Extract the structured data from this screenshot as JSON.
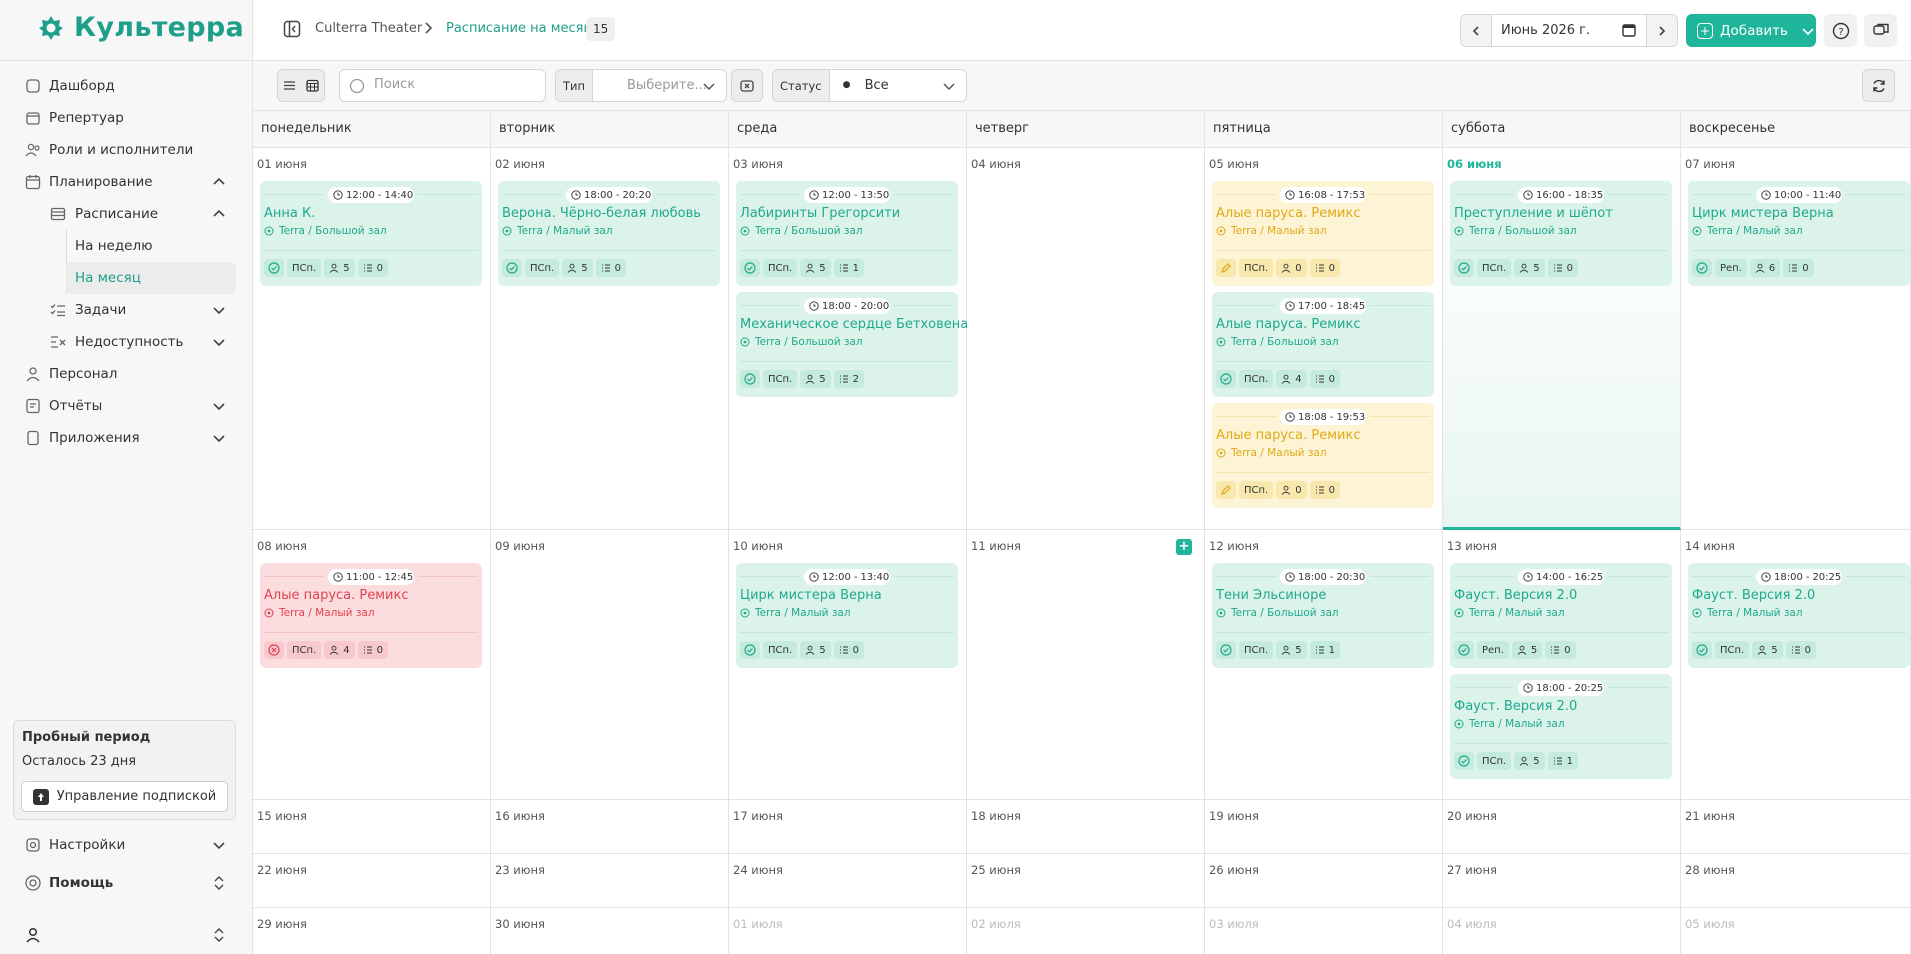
{
  "app": {
    "name": "Культерра"
  },
  "sidebar": {
    "items": [
      {
        "label": "Дашборд",
        "icon": "home-icon",
        "level": 0
      },
      {
        "label": "Репертуар",
        "icon": "repertoire-icon",
        "level": 0
      },
      {
        "label": "Роли и исполнители",
        "icon": "users-icon",
        "level": 0
      },
      {
        "label": "Планирование",
        "icon": "calendar-icon",
        "level": 0,
        "chevron": "up"
      },
      {
        "label": "Расписание",
        "icon": "table-icon",
        "level": 1,
        "chevron": "up"
      },
      {
        "label": "На неделю",
        "level": 2
      },
      {
        "label": "На месяц",
        "level": 2,
        "active": true
      },
      {
        "label": "Задачи",
        "icon": "tasks-icon",
        "level": 1,
        "chevron": "down"
      },
      {
        "label": "Недоступность",
        "icon": "unavailability-icon",
        "level": 1,
        "chevron": "down"
      },
      {
        "label": "Персонал",
        "icon": "staff-icon",
        "level": 0
      },
      {
        "label": "Отчёты",
        "icon": "report-icon",
        "level": 0,
        "chevron": "down"
      },
      {
        "label": "Приложения",
        "icon": "apps-icon",
        "level": 0,
        "chevron": "down"
      }
    ],
    "trial": {
      "title": "Пробный период",
      "remaining": "Осталось 23 дня",
      "button": "Управление подпиской"
    },
    "settings": "Настройки",
    "help": "Помощь"
  },
  "header": {
    "breadcrumb_root": "Culterra Theater",
    "breadcrumb_current": "Расписание на месяц",
    "count_badge": "15",
    "month": "Июнь 2026 г.",
    "add_button": "Добавить"
  },
  "toolbar": {
    "search_placeholder": "Поиск",
    "type_label": "Тип",
    "type_placeholder": "Выберите...",
    "status_label": "Статус",
    "status_value": "Все"
  },
  "colors": {
    "accent": "#1fb59a",
    "event_green": "#dcf3ea",
    "event_yellow": "#fdf4d6",
    "event_red": "#fbdde0"
  },
  "calendar": {
    "weekdays": [
      "понедельник",
      "вторник",
      "среда",
      "четверг",
      "пятница",
      "суббота",
      "воскресенье"
    ],
    "weeks": [
      [
        {
          "date": "01 июня",
          "events": [
            {
              "time_start": "12:00",
              "time_end": "14:40",
              "title": "Анна К.",
              "venue": "Terra / Большой зал",
              "color": "green",
              "status": "ok",
              "type": "ПСп.",
              "cast": "5",
              "tasks": "0"
            }
          ]
        },
        {
          "date": "02 июня",
          "events": [
            {
              "time_start": "18:00",
              "time_end": "20:20",
              "title": "Верона. Чёрно-белая любовь",
              "venue": "Terra / Малый зал",
              "color": "green",
              "status": "ok",
              "type": "ПСп.",
              "cast": "5",
              "tasks": "0"
            }
          ]
        },
        {
          "date": "03 июня",
          "events": [
            {
              "time_start": "12:00",
              "time_end": "13:50",
              "title": "Лабиринты Грегорсити",
              "venue": "Terra / Большой зал",
              "color": "green",
              "status": "ok",
              "type": "ПСп.",
              "cast": "5",
              "tasks": "1"
            },
            {
              "time_start": "18:00",
              "time_end": "20:00",
              "title": "Механическое сердце Бетховена",
              "venue": "Terra / Большой зал",
              "color": "green",
              "status": "ok",
              "type": "ПСп.",
              "cast": "5",
              "tasks": "2"
            }
          ]
        },
        {
          "date": "04 июня",
          "events": []
        },
        {
          "date": "05 июня",
          "events": [
            {
              "time_start": "16:08",
              "time_end": "17:53",
              "title": "Алые паруса. Ремикс",
              "venue": "Terra / Малый зал",
              "color": "yellow",
              "status": "draft",
              "type": "ПСп.",
              "cast": "0",
              "tasks": "0"
            },
            {
              "time_start": "17:00",
              "time_end": "18:45",
              "title": "Алые паруса. Ремикс",
              "venue": "Terra / Большой зал",
              "color": "green",
              "status": "ok",
              "type": "ПСп.",
              "cast": "4",
              "tasks": "0"
            },
            {
              "time_start": "18:08",
              "time_end": "19:53",
              "title": "Алые паруса. Ремикс",
              "venue": "Terra / Малый зал",
              "color": "yellow",
              "status": "draft",
              "type": "ПСп.",
              "cast": "0",
              "tasks": "0"
            }
          ]
        },
        {
          "date": "06 июня",
          "today": true,
          "events": [
            {
              "time_start": "16:00",
              "time_end": "18:35",
              "title": "Преступление и шёпот",
              "venue": "Terra / Большой зал",
              "color": "green",
              "status": "ok",
              "type": "ПСп.",
              "cast": "5",
              "tasks": "0"
            }
          ]
        },
        {
          "date": "07 июня",
          "events": [
            {
              "time_start": "10:00",
              "time_end": "11:40",
              "title": "Цирк мистера Верна",
              "venue": "Terra / Малый зал",
              "color": "green",
              "status": "ok",
              "type": "Реп.",
              "cast": "6",
              "tasks": "0"
            }
          ]
        }
      ],
      [
        {
          "date": "08 июня",
          "events": [
            {
              "time_start": "11:00",
              "time_end": "12:45",
              "title": "Алые паруса. Ремикс",
              "venue": "Terra / Малый зал",
              "color": "red",
              "status": "cancelled",
              "type": "ПСп.",
              "cast": "4",
              "tasks": "0"
            }
          ]
        },
        {
          "date": "09 июня",
          "events": []
        },
        {
          "date": "10 июня",
          "events": [
            {
              "time_start": "12:00",
              "time_end": "13:40",
              "title": "Цирк мистера Верна",
              "venue": "Terra / Малый зал",
              "color": "green",
              "status": "ok",
              "type": "ПСп.",
              "cast": "5",
              "tasks": "0"
            }
          ]
        },
        {
          "date": "11 июня",
          "add": true,
          "events": []
        },
        {
          "date": "12 июня",
          "events": [
            {
              "time_start": "18:00",
              "time_end": "20:30",
              "title": "Тени Эльсиноре",
              "venue": "Terra / Большой зал",
              "color": "green",
              "status": "ok",
              "type": "ПСп.",
              "cast": "5",
              "tasks": "1"
            }
          ]
        },
        {
          "date": "13 июня",
          "events": [
            {
              "time_start": "14:00",
              "time_end": "16:25",
              "title": "Фауст. Версия 2.0",
              "venue": "Terra / Малый зал",
              "color": "green",
              "status": "ok",
              "type": "Реп.",
              "cast": "5",
              "tasks": "0"
            },
            {
              "time_start": "18:00",
              "time_end": "20:25",
              "title": "Фауст. Версия 2.0",
              "venue": "Terra / Малый зал",
              "color": "green",
              "status": "ok",
              "type": "ПСп.",
              "cast": "5",
              "tasks": "1"
            }
          ]
        },
        {
          "date": "14 июня",
          "events": [
            {
              "time_start": "18:00",
              "time_end": "20:25",
              "title": "Фауст. Версия 2.0",
              "venue": "Terra / Малый зал",
              "color": "green",
              "status": "ok",
              "type": "ПСп.",
              "cast": "5",
              "tasks": "0"
            }
          ]
        }
      ],
      [
        {
          "date": "15 июня",
          "events": []
        },
        {
          "date": "16 июня",
          "events": []
        },
        {
          "date": "17 июня",
          "events": []
        },
        {
          "date": "18 июня",
          "events": []
        },
        {
          "date": "19 июня",
          "events": []
        },
        {
          "date": "20 июня",
          "events": []
        },
        {
          "date": "21 июня",
          "events": []
        }
      ],
      [
        {
          "date": "22 июня",
          "events": []
        },
        {
          "date": "23 июня",
          "events": []
        },
        {
          "date": "24 июня",
          "events": []
        },
        {
          "date": "25 июня",
          "events": []
        },
        {
          "date": "26 июня",
          "events": []
        },
        {
          "date": "27 июня",
          "events": []
        },
        {
          "date": "28 июня",
          "events": []
        }
      ],
      [
        {
          "date": "29 июня",
          "events": []
        },
        {
          "date": "30 июня",
          "events": []
        },
        {
          "date": "01 июля",
          "other": true,
          "events": []
        },
        {
          "date": "02 июля",
          "other": true,
          "events": []
        },
        {
          "date": "03 июля",
          "other": true,
          "events": []
        },
        {
          "date": "04 июля",
          "other": true,
          "events": []
        },
        {
          "date": "05 июля",
          "other": true,
          "events": []
        }
      ]
    ]
  }
}
